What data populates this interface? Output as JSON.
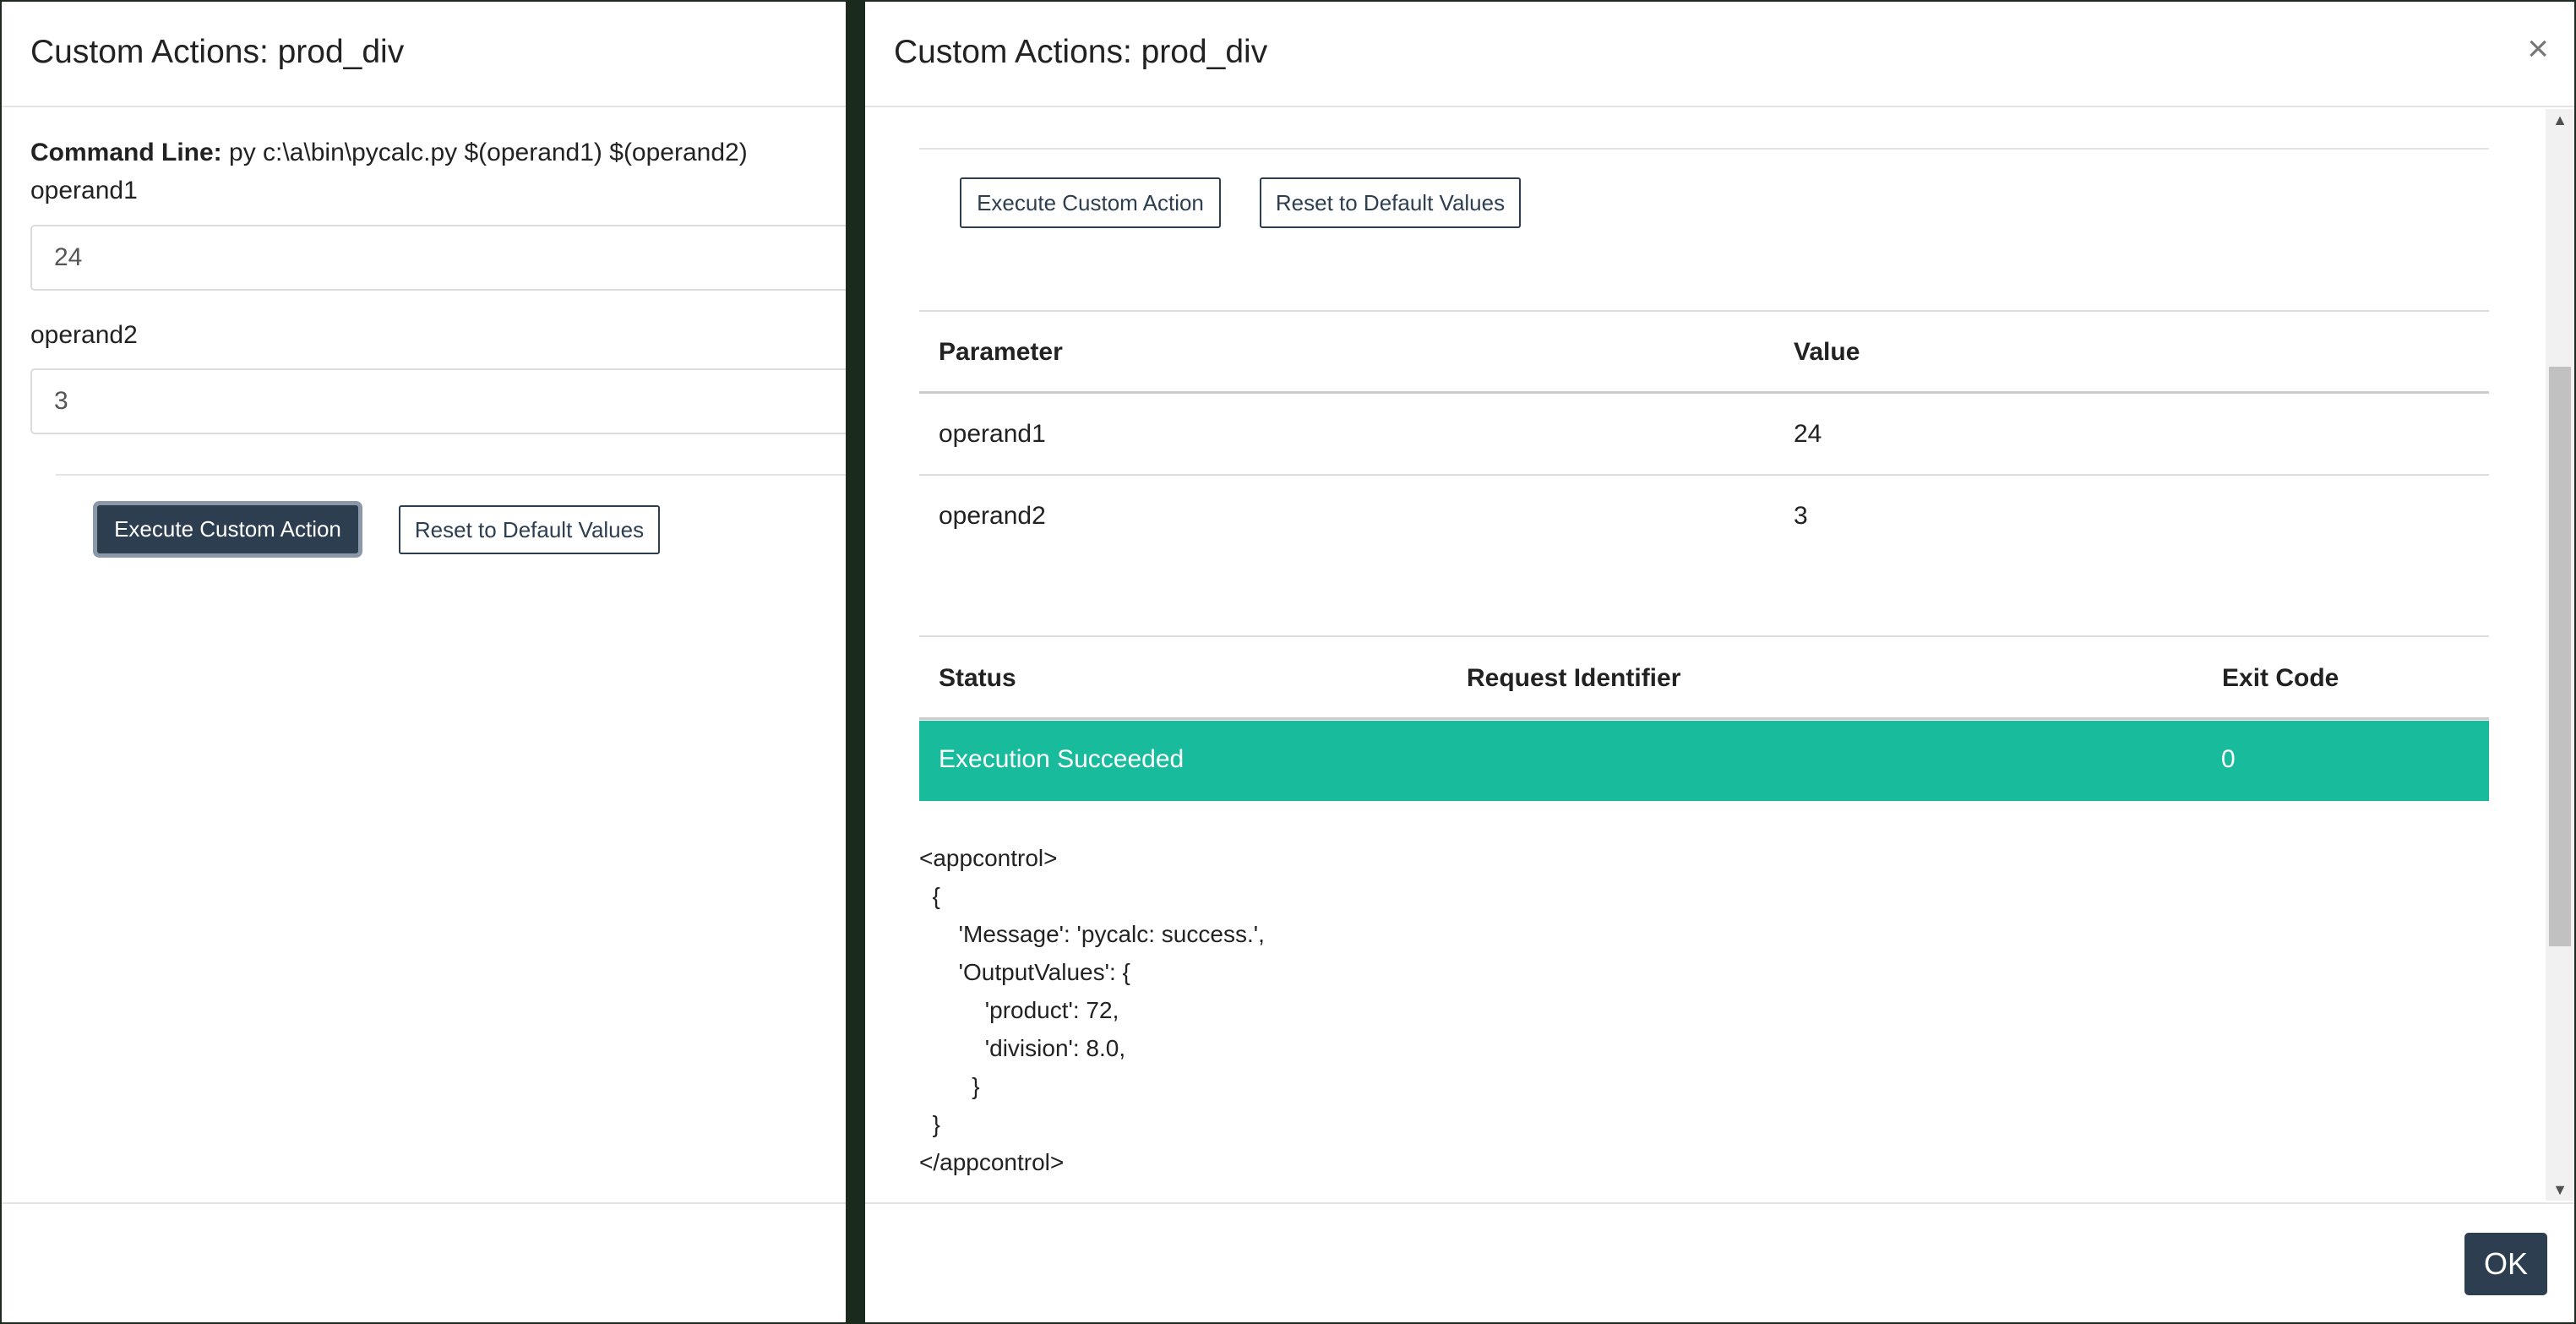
{
  "left_modal": {
    "title": "Custom Actions: prod_div",
    "command_line_label": "Command Line:",
    "command_line_value": " py c:\\a\\bin\\pycalc.py $(operand1) $(operand2)",
    "fields": [
      {
        "label": "operand1",
        "value": "24"
      },
      {
        "label": "operand2",
        "value": "3"
      }
    ],
    "execute_label": "Execute Custom Action",
    "reset_label": "Reset to Default Values"
  },
  "right_modal": {
    "title": "Custom Actions: prod_div",
    "close_glyph": "×",
    "execute_label": "Execute Custom Action",
    "reset_label": "Reset to Default Values",
    "params_table": {
      "headers": [
        "Parameter",
        "Value"
      ],
      "rows": [
        [
          "operand1",
          "24"
        ],
        [
          "operand2",
          "3"
        ]
      ]
    },
    "status_table": {
      "headers": [
        "Status",
        "Request Identifier",
        "Exit Code"
      ],
      "row": [
        "Execution Succeeded",
        "",
        "0"
      ],
      "row_color": "#18bc9c"
    },
    "output_lines": [
      "<appcontrol>",
      "  {",
      "      'Message': 'pycalc: success.',",
      "      'OutputValues': {",
      "          'product': 72,",
      "          'division': 8.0,",
      "        }",
      "  }",
      "</appcontrol>"
    ],
    "ok_label": "OK"
  },
  "colors": {
    "primary": "#2c3e50",
    "success": "#18bc9c"
  }
}
